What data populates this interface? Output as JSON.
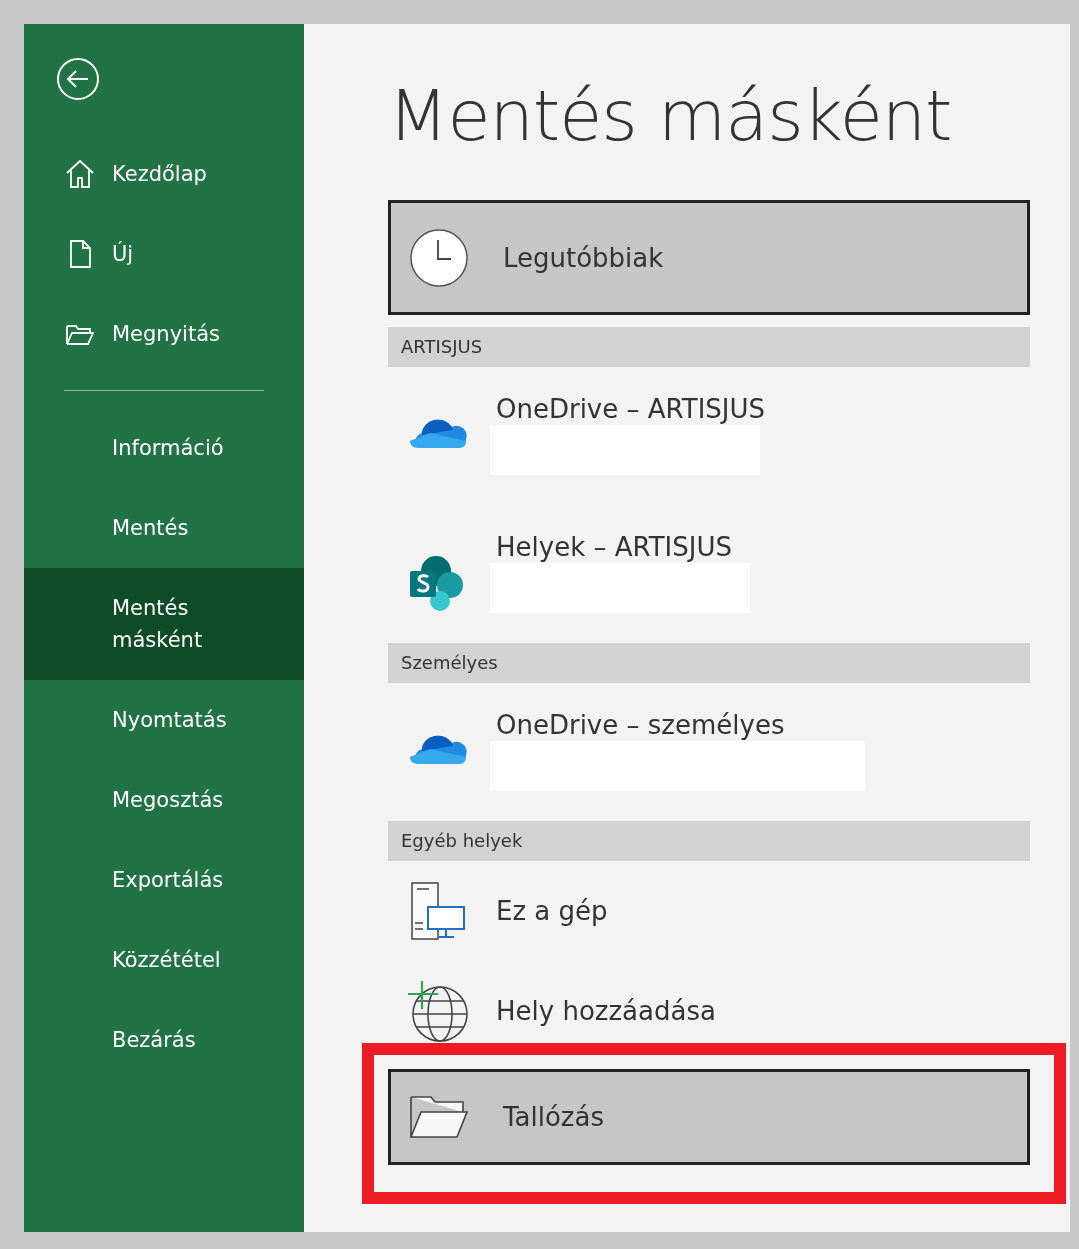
{
  "sidebar": {
    "top_items": [
      {
        "label": "Kezdőlap"
      },
      {
        "label": "Új"
      },
      {
        "label": "Megnyitás"
      }
    ],
    "items": [
      {
        "label": "Információ",
        "selected": false
      },
      {
        "label": "Mentés",
        "selected": false
      },
      {
        "label": "Mentés másként",
        "selected": true
      },
      {
        "label": "Nyomtatás",
        "selected": false
      },
      {
        "label": "Megosztás",
        "selected": false
      },
      {
        "label": "Exportálás",
        "selected": false
      },
      {
        "label": "Közzététel",
        "selected": false
      },
      {
        "label": "Bezárás",
        "selected": false
      }
    ]
  },
  "title": "Mentés másként",
  "places": [
    {
      "kind": "recent",
      "label": "Legutóbbiak",
      "selected": true,
      "highlighted": false
    },
    {
      "kind": "header",
      "label": "ARTISJUS"
    },
    {
      "kind": "cloud",
      "label": "OneDrive – ARTISJUS",
      "redacted": true
    },
    {
      "kind": "sharepoint",
      "label": "Helyek – ARTISJUS",
      "redacted": true
    },
    {
      "kind": "header",
      "label": "Személyes"
    },
    {
      "kind": "cloud",
      "label": "OneDrive – személyes",
      "redacted": true
    },
    {
      "kind": "header",
      "label": "Egyéb helyek"
    },
    {
      "kind": "computer",
      "label": "Ez a gép",
      "redacted": false
    },
    {
      "kind": "add-place",
      "label": "Hely hozzáadása",
      "redacted": false
    },
    {
      "kind": "browse",
      "label": "Tallózás",
      "selected": true,
      "highlighted": true
    }
  ]
}
